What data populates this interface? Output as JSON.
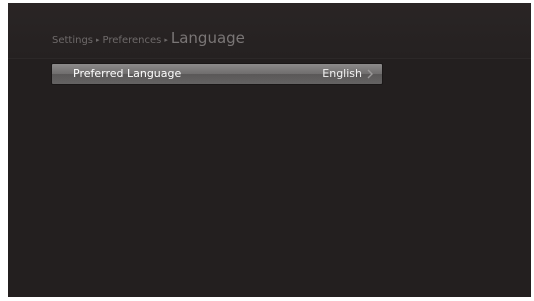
{
  "breadcrumb": {
    "level1": "Settings",
    "level2": "Preferences",
    "current": "Language",
    "separator": "▸"
  },
  "settings": {
    "items": [
      {
        "label": "Preferred Language",
        "value": "English"
      }
    ]
  },
  "colors": {
    "background": "#231f1f",
    "highlight": "#7a7878",
    "text_dim": "#6e6a6a",
    "text_bright": "#ffffff"
  },
  "icons": {
    "row_chevron": "chevron-right-icon"
  }
}
